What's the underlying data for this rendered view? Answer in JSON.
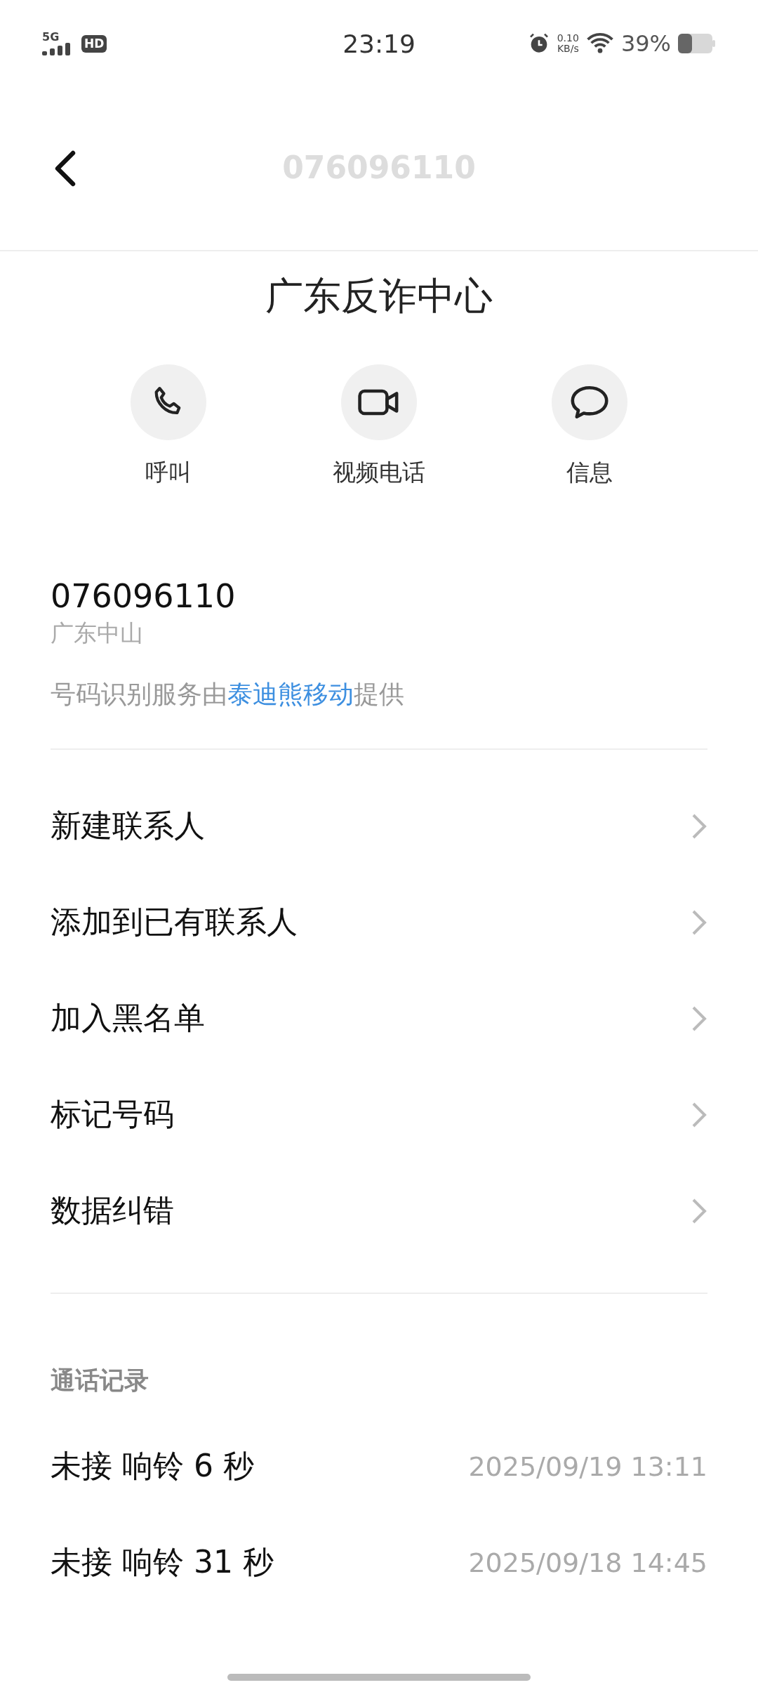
{
  "status_bar": {
    "network": "5G",
    "hd": "HD",
    "time": "23:19",
    "speed_value": "0.10",
    "speed_unit": "KB/s",
    "battery": "39%"
  },
  "header": {
    "title": "076096110"
  },
  "contact": {
    "name": "广东反诈中心"
  },
  "actions": [
    {
      "kind": "call",
      "label": "呼叫"
    },
    {
      "kind": "video",
      "label": "视频电话"
    },
    {
      "kind": "message",
      "label": "信息"
    }
  ],
  "number": {
    "value": "076096110",
    "location": "广东中山",
    "provider_text": "号码识别服务由**泰迪熊移动**提供"
  },
  "menu": [
    {
      "label": "新建联系人"
    },
    {
      "label": "添加到已有联系人"
    },
    {
      "label": "加入黑名单"
    },
    {
      "label": "标记号码"
    },
    {
      "label": "数据纠错"
    }
  ],
  "call_log": {
    "title": "通话记录",
    "rows": [
      {
        "status": "未接 响铃 6 秒",
        "time": "2025/09/19 13:11"
      },
      {
        "status": "未接 响铃 31 秒",
        "time": "2025/09/18 14:45"
      }
    ]
  }
}
